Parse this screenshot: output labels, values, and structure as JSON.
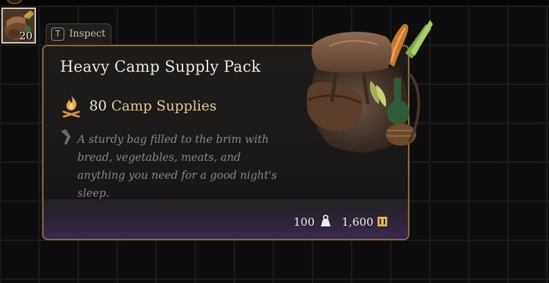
{
  "inventory": {
    "slot": {
      "icon": "camp-supply-pack-icon",
      "count": "20"
    }
  },
  "inspect": {
    "key": "T",
    "label": "Inspect"
  },
  "tooltip": {
    "title": "Heavy Camp Supply Pack",
    "supplies": {
      "amount": "80",
      "label": "Camp Supplies",
      "icon": "campfire-icon"
    },
    "description": "A sturdy bag filled to the brim with bread, vegetables, meats, and anything you need for a good night's sleep.",
    "weight": {
      "value": "100",
      "icon": "weight-icon"
    },
    "gold": {
      "value": "1,600",
      "icon": "gold-coin-icon"
    },
    "art_icon": "supply-pack-icon"
  },
  "colors": {
    "border": "#8a6a44",
    "supply_label": "#e7c995",
    "footer_purple": "#3a2a4e"
  }
}
